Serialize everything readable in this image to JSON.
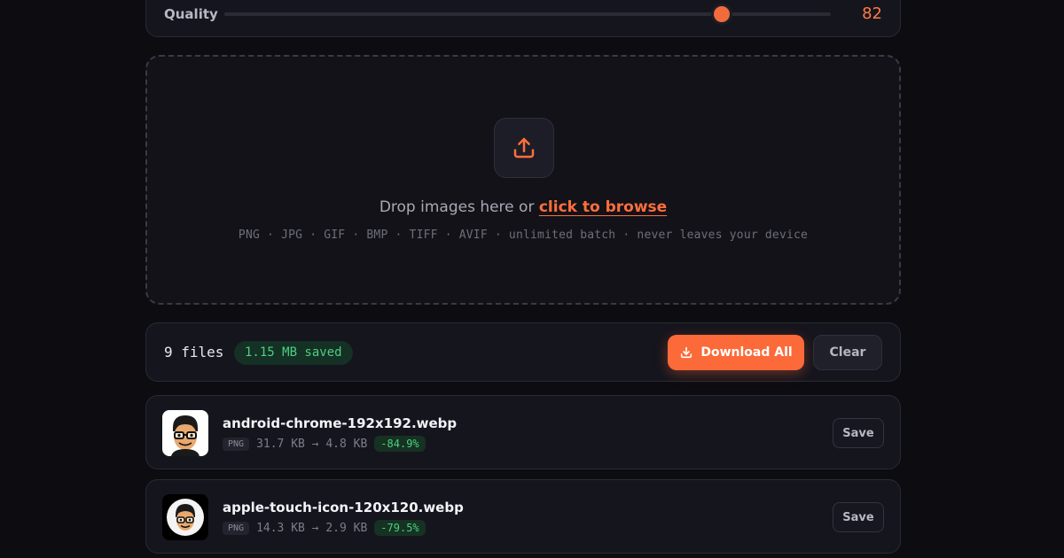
{
  "quality": {
    "label": "Quality",
    "value": "82",
    "level": 0.82,
    "accent": "#f26b3a"
  },
  "dropzone": {
    "icon": "upload-icon",
    "prompt": "Drop images here or",
    "link": "click to browse",
    "formats": "PNG · JPG · GIF · BMP · TIFF · AVIF · unlimited batch · never leaves your device"
  },
  "summary": {
    "files_count": "9 files",
    "saved": "1.15 MB saved",
    "download_all": "Download All",
    "download_icon": "download-icon",
    "clear": "Clear"
  },
  "files": [
    {
      "name": "android-chrome-192x192.webp",
      "format": "PNG",
      "sizes": "31.7 KB → 4.8 KB",
      "reduction": "-84.9%",
      "save": "Save",
      "thumb_bg": "#ffffff"
    },
    {
      "name": "apple-touch-icon-120x120.webp",
      "format": "PNG",
      "sizes": "14.3 KB → 2.9 KB",
      "reduction": "-79.5%",
      "save": "Save",
      "thumb_bg": "#000000"
    }
  ],
  "colors": {
    "background": "#0c0c11",
    "card": "#15151d",
    "accent": "#fb6a38",
    "success": "#4ccf82"
  }
}
